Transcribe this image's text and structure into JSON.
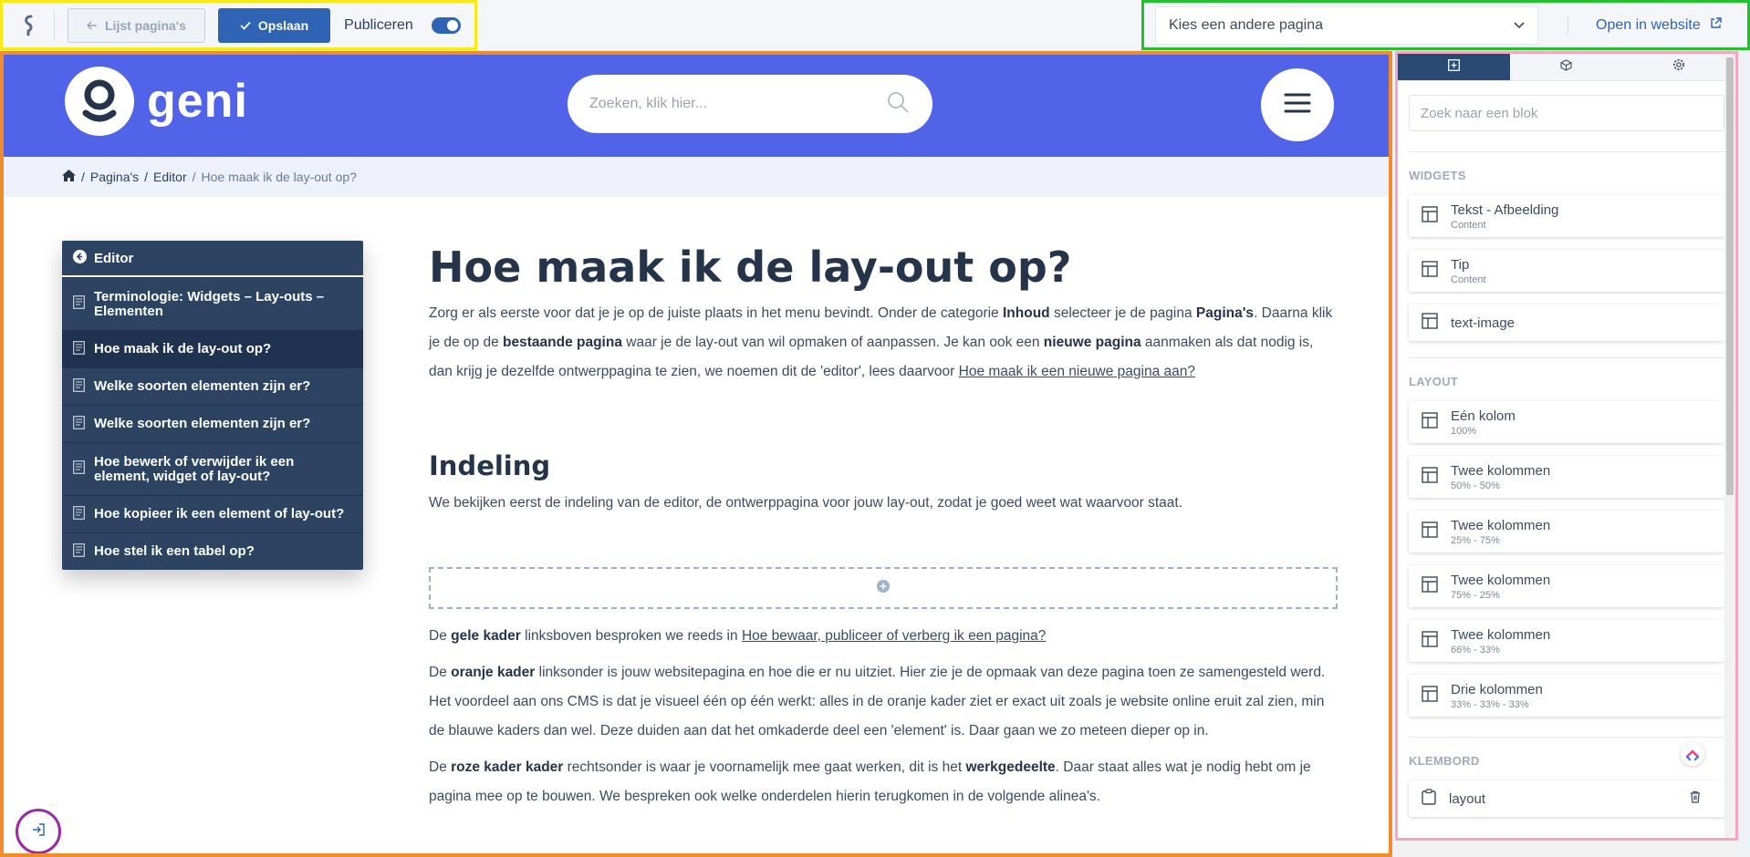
{
  "topbar": {
    "list_button": "Lijst pagina's",
    "save_button": "Opslaan",
    "publish_label": "Publiceren",
    "page_select_value": "Kies een andere pagina",
    "open_link": "Open in website"
  },
  "site": {
    "logo_text": "geni",
    "search_placeholder": "Zoeken, klik hier...",
    "breadcrumb": [
      "/",
      "Pagina's",
      "/",
      "Editor",
      "/",
      "Hoe maak ik de lay-out op?"
    ]
  },
  "side_menu": {
    "title": "Editor",
    "items": [
      "Terminologie: Widgets – Lay-outs – Elementen",
      "Hoe maak ik de lay-out op?",
      "Welke soorten elementen zijn er?",
      "Welke soorten elementen zijn er?",
      "Hoe bewerk of verwijder ik een element, widget of lay-out?",
      "Hoe kopieer ik een element of lay-out?",
      "Hoe stel ik een tabel op?"
    ]
  },
  "content": {
    "title": "Hoe maak ik de lay-out op?",
    "intro": [
      "Zorg er als eerste voor dat je je op de juiste plaats in het menu bevindt. Onder de categorie ",
      "Inhoud",
      " selecteer je de pagina ",
      "Pagina's",
      ". Daarna klik je de op de ",
      "bestaande pagina",
      " waar je de lay-out van wil opmaken of aanpassen. Je kan ook een ",
      "nieuwe pagina",
      " aanmaken als dat nodig is, dan krijg je dezelfde ontwerppagina te zien, we noemen dit de 'editor', lees daarvoor ",
      "Hoe maak ik een nieuwe pagina aan?"
    ],
    "h2": "Indeling",
    "p2": "We bekijken eerst de indeling van de editor, de ontwerppagina voor jouw lay-out, zodat je goed weet wat waarvoor staat.",
    "p3": [
      "De ",
      "gele kader",
      " linksboven besproken we reeds in ",
      "Hoe bewaar, publiceer of verberg ik een pagina?"
    ],
    "p4": [
      "De ",
      "oranje kader",
      " linksonder is jouw websitepagina en hoe die er nu uitziet. Hier zie je de opmaak van deze pagina toen ze samengesteld werd. Het voordeel aan ons CMS is dat je visueel één op één werkt: alles in de oranje kader ziet er exact uit zoals je website online eruit zal zien, min de blauwe kaders dan wel. Deze duiden aan dat het omkaderde deel een 'element' is. Daar gaan we zo meteen dieper op in."
    ],
    "p5": [
      "De ",
      "roze kader kader",
      " rechtsonder is waar je voornamelijk mee gaat werken, dit is het ",
      "werkgedeelte",
      ". Daar staat alles wat je nodig hebt om je pagina mee op te bouwen. We bespreken ook welke onderdelen hierin terugkomen in de volgende alinea's."
    ]
  },
  "panel": {
    "search_placeholder": "Zoek naar een blok",
    "widgets_title": "WIDGETS",
    "widgets": [
      {
        "title": "Tekst - Afbeelding",
        "sub": "Content"
      },
      {
        "title": "Tip",
        "sub": "Content"
      },
      {
        "title": "text-image",
        "sub": ""
      }
    ],
    "layout_title": "LAYOUT",
    "layouts": [
      {
        "title": "Eén kolom",
        "sub": "100%"
      },
      {
        "title": "Twee kolommen",
        "sub": "50% - 50%"
      },
      {
        "title": "Twee kolommen",
        "sub": "25% - 75%"
      },
      {
        "title": "Twee kolommen",
        "sub": "75% - 25%"
      },
      {
        "title": "Twee kolommen",
        "sub": "66% - 33%"
      },
      {
        "title": "Drie kolommen",
        "sub": "33% - 33% - 33%"
      }
    ],
    "clipboard_title": "KLEMBORD",
    "clipboard": [
      {
        "title": "layout"
      }
    ]
  },
  "colors": {
    "yellow_frame": "#f7ea16",
    "green_frame": "#22c12e",
    "orange_frame": "#f28c2b",
    "pink_frame": "#f5a6c3",
    "purple_frame": "#9a2aa8",
    "primary": "#2f64b4",
    "site_header": "#5163e8"
  },
  "icons": [
    "app-logo-icon",
    "arrow-left-icon",
    "check-icon",
    "chevron-down-icon",
    "external-link-icon",
    "search-icon",
    "hamburger-icon",
    "home-icon",
    "arrow-circle-left-icon",
    "document-icon",
    "plus-circle-icon",
    "exit-icon",
    "add-block-icon",
    "cube-icon",
    "gear-icon",
    "layout-icon",
    "clipboard-icon",
    "trash-icon",
    "clickup-icon"
  ]
}
